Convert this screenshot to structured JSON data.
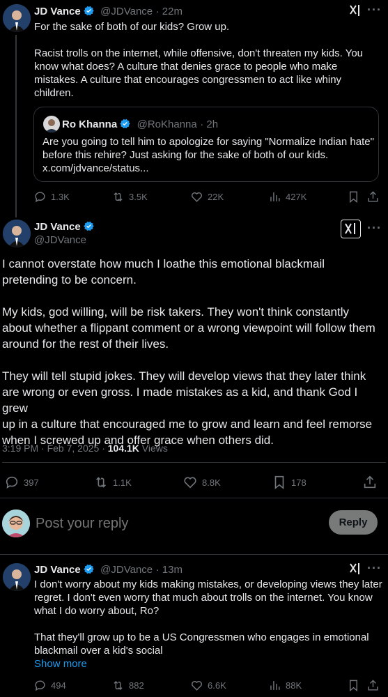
{
  "tweet1": {
    "name": "JD Vance",
    "handle": "@JDVance",
    "time": "· 22m",
    "lines": [
      "For the sake of both of our kids? Grow up.",
      "",
      "Racist trolls on the internet, while offensive, don't threaten my kids. You",
      "know what does? A culture that denies grace to people who make",
      "mistakes. A culture that encourages congressmen to act like whiny",
      "children."
    ],
    "quote": {
      "name": "Ro Khanna",
      "handle": "@RoKhanna",
      "time": "· 2h",
      "lines": [
        "Are you going to tell him to apologize for saying \"Normalize Indian hate\"",
        "before this rehire? Just asking for the sake of both of our kids.",
        "x.com/jdvance/status..."
      ]
    },
    "metrics": {
      "replies": "1.3K",
      "reposts": "3.5K",
      "likes": "22K",
      "views": "427K"
    }
  },
  "main_tweet": {
    "name": "JD Vance",
    "handle": "@JDVance",
    "lines": [
      "I cannot overstate how much I loathe this emotional blackmail",
      "pretending to be concern.",
      "",
      "My kids, god willing, will be risk takers. They won't think constantly",
      "about whether a flippant comment or a wrong viewpoint will follow them",
      "around for the rest of their lives.",
      "",
      "They will tell stupid jokes. They will develop views that they later think",
      "are wrong or even gross. I made mistakes as a kid, and thank God I grew",
      "up in a culture that encouraged me to grow and learn and feel remorse",
      "when I screwed up and offer grace when others did."
    ],
    "timestamp": "3:19 PM · Feb 7, 2025 · ",
    "views_count": "104.1K",
    "views_label": " Views",
    "metrics": {
      "replies": "397",
      "reposts": "1.1K",
      "likes": "8.8K",
      "bookmarks": "178"
    }
  },
  "reply_box": {
    "placeholder": "Post your reply",
    "button": "Reply"
  },
  "tweet3": {
    "name": "JD Vance",
    "handle": "@JDVance",
    "time": "· 13m",
    "lines": [
      "I don't worry about my kids making mistakes, or developing views they later",
      "regret. I don't even worry that much about trolls on the internet. You know",
      "what I do worry about, Ro?",
      "",
      "That they'll grow up to be a US Congressmen who engages in emotional",
      "blackmail over a kid's social"
    ],
    "show_more": "Show more",
    "metrics": {
      "replies": "494",
      "reposts": "882",
      "likes": "6.6K",
      "views": "88K"
    }
  },
  "colors": {
    "background": "#000000",
    "text": "#e7e9ea",
    "muted": "#71767b",
    "accent": "#1d9bf0",
    "divider": "#2f3336"
  }
}
